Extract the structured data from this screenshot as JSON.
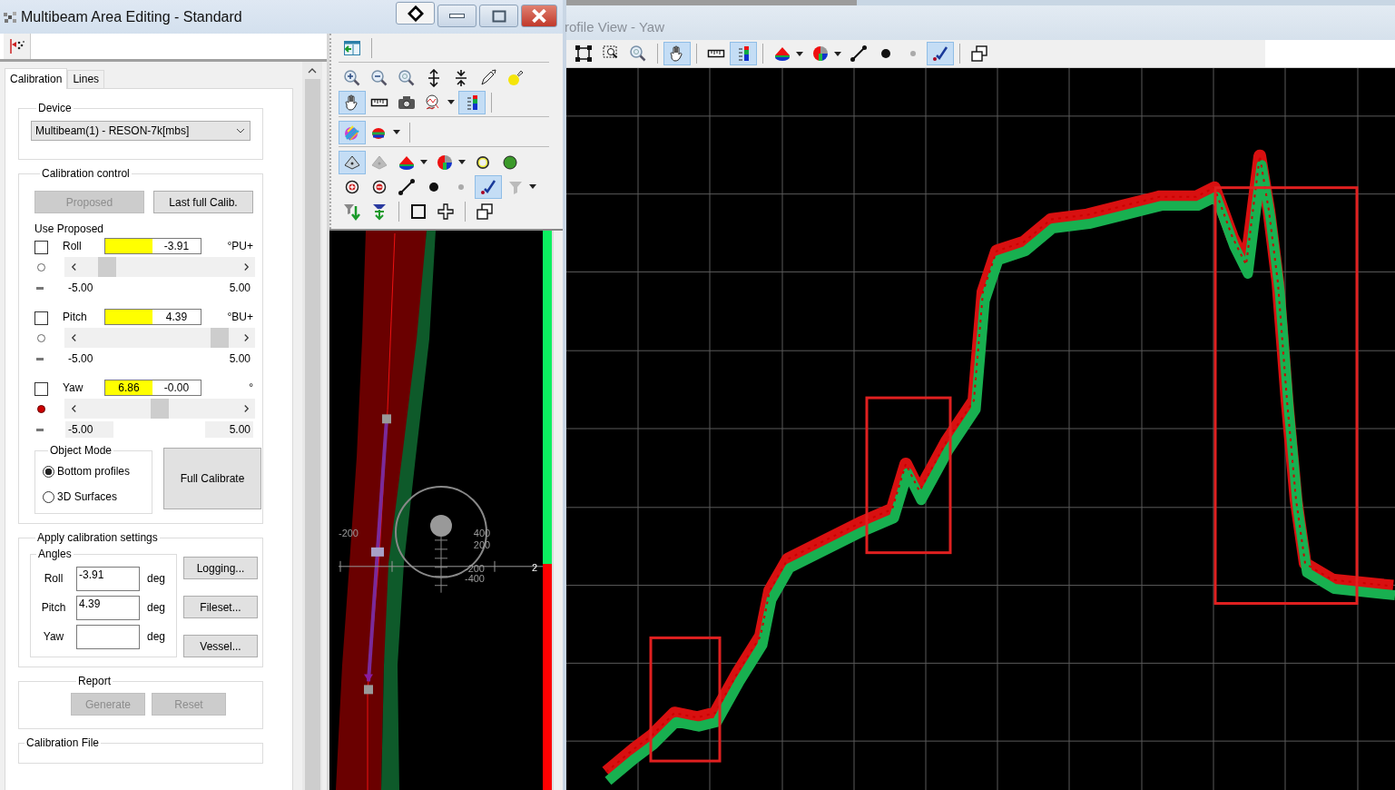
{
  "window": {
    "title": "Multibeam Area Editing - Standard",
    "buttons": [
      {
        "kind": "pin"
      },
      {
        "kind": "minimize"
      },
      {
        "kind": "maximize"
      },
      {
        "kind": "close"
      }
    ]
  },
  "panel_toolbar": [
    {
      "kind": "cursor-scatter",
      "selected": false
    }
  ],
  "tabs": [
    {
      "label": "Calibration",
      "selected": true
    },
    {
      "label": "Lines",
      "selected": false
    }
  ],
  "device": {
    "legend": "Device",
    "value": "Multibeam(1) - RESON-7k[mbs]"
  },
  "calibration_control": {
    "legend": "Calibration control",
    "buttons": [
      {
        "label": "Proposed",
        "disabled": true
      },
      {
        "label": "Last full Calib.",
        "disabled": false
      }
    ],
    "use_proposed": "Use Proposed",
    "axes": [
      {
        "label": "Roll",
        "checked": false,
        "value": "-3.91",
        "unit": "°PU+",
        "active": false,
        "level": 0.11,
        "min": "-5.00",
        "max": "5.00"
      },
      {
        "label": "Pitch",
        "checked": false,
        "value": "4.39",
        "unit": "°BU+",
        "active": false,
        "level": 0.94,
        "min": "-5.00",
        "max": "5.00"
      },
      {
        "label": "Yaw",
        "checked": false,
        "proposed": "6.86",
        "value": "-0.00",
        "unit": "°",
        "active": true,
        "level": 0.5,
        "min": "-5.00",
        "max": "5.00"
      }
    ]
  },
  "object_mode": {
    "legend": "Object Mode",
    "options": [
      {
        "label": "Bottom profiles",
        "selected": true
      },
      {
        "label": "3D Surfaces",
        "selected": false
      }
    ],
    "button": "Full Calibrate"
  },
  "apply": {
    "legend": "Apply calibration settings",
    "angles_legend": "Angles",
    "angles": [
      {
        "label": "Roll",
        "value": "-3.91",
        "unit": "deg"
      },
      {
        "label": "Pitch",
        "value": "4.39",
        "unit": "deg"
      },
      {
        "label": "Yaw",
        "unit": "deg"
      }
    ],
    "buttons": [
      "Logging...",
      "Fileset...",
      "Vessel..."
    ]
  },
  "report": {
    "legend": "Report",
    "buttons": [
      {
        "label": "Generate",
        "disabled": true
      },
      {
        "label": "Reset",
        "disabled": true
      }
    ]
  },
  "calibration_file": {
    "legend": "Calibration File"
  },
  "map_toolbar": [
    [
      [
        {
          "kind": "panel-arrow",
          "selected": false
        },
        {
          "kind": "separator"
        }
      ]
    ],
    [
      [
        {
          "kind": "magnifier-plus",
          "selected": false
        },
        {
          "kind": "magnifier-minus",
          "selected": false
        },
        {
          "kind": "magnifier-target",
          "selected": false
        },
        {
          "kind": "arrows-apart",
          "selected": false
        },
        {
          "kind": "arrows-together",
          "selected": false
        },
        {
          "kind": "pen",
          "selected": false
        },
        {
          "kind": "bulb",
          "selected": false
        }
      ],
      [
        {
          "kind": "hand",
          "selected": true
        },
        {
          "kind": "ruler",
          "selected": false
        },
        {
          "kind": "camera",
          "selected": false
        },
        {
          "kind": "graph-magnifier",
          "selected": false
        },
        {
          "kind": "caret"
        },
        {
          "kind": "color-scale",
          "selected": true
        },
        {
          "kind": "separator"
        }
      ]
    ],
    [
      [
        {
          "kind": "striped-blob",
          "selected": true
        },
        {
          "kind": "color-blob",
          "selected": false
        },
        {
          "kind": "caret"
        },
        {
          "kind": "separator"
        }
      ]
    ],
    [
      [
        {
          "kind": "surface",
          "selected": true
        },
        {
          "kind": "faded-surface",
          "selected": false
        },
        {
          "kind": "striped-cone",
          "selected": false
        },
        {
          "kind": "caret"
        },
        {
          "kind": "quad-sphere",
          "selected": false
        },
        {
          "kind": "caret"
        },
        {
          "kind": "ring",
          "selected": false
        },
        {
          "kind": "ball",
          "selected": false
        }
      ],
      [
        {
          "kind": "circle-plus",
          "selected": false
        },
        {
          "kind": "circle-minus",
          "selected": false
        },
        {
          "kind": "line-nodes",
          "selected": false
        },
        {
          "kind": "dot",
          "selected": false
        },
        {
          "kind": "small-dot",
          "selected": false
        },
        {
          "kind": "checkmark",
          "selected": true
        },
        {
          "kind": "funnel",
          "selected": false
        },
        {
          "kind": "caret"
        }
      ],
      [
        {
          "kind": "funnel-down",
          "selected": false
        },
        {
          "kind": "funnel-split",
          "selected": false
        },
        {
          "kind": "separator"
        },
        {
          "kind": "square",
          "selected": false
        },
        {
          "kind": "cross",
          "selected": false
        },
        {
          "kind": "separator"
        },
        {
          "kind": "windows",
          "selected": false
        }
      ]
    ]
  ],
  "map": {
    "labels": [
      "-200",
      "400",
      "200",
      "-200",
      "-400",
      "2"
    ]
  },
  "profile_view": {
    "title": "rofile View - Yaw",
    "toolbar": [
      {
        "kind": "frame-corners",
        "selected": false
      },
      {
        "kind": "zoom-rect",
        "selected": false
      },
      {
        "kind": "magnifier-target",
        "selected": false
      },
      {
        "kind": "separator"
      },
      {
        "kind": "hand",
        "selected": true
      },
      {
        "kind": "separator"
      },
      {
        "kind": "ruler",
        "selected": false
      },
      {
        "kind": "color-scale",
        "selected": true
      },
      {
        "kind": "separator"
      },
      {
        "kind": "striped-cone",
        "selected": false
      },
      {
        "kind": "caret"
      },
      {
        "kind": "quad-sphere",
        "selected": false
      },
      {
        "kind": "caret"
      },
      {
        "kind": "line-nodes",
        "selected": false
      },
      {
        "kind": "dot",
        "selected": false
      },
      {
        "kind": "small-dot",
        "selected": false
      },
      {
        "kind": "checkmark",
        "selected": true
      },
      {
        "kind": "separator"
      },
      {
        "kind": "windows",
        "selected": false
      }
    ]
  }
}
